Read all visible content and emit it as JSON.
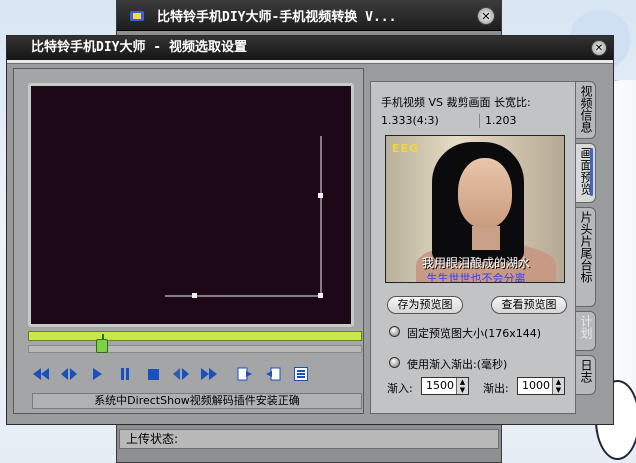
{
  "back_window": {
    "title": "比特铃手机DIY大师-手机视频转换 V...",
    "upload_label": "上传状态:"
  },
  "main_window": {
    "title": "比特铃手机DIY大师 - 视频选取设置"
  },
  "player": {
    "status_text": "系统中DirectShow视频解码插件安装正确",
    "controls": [
      {
        "name": "rewind-icon",
        "glyph": "◀◀"
      },
      {
        "name": "step-back-icon",
        "glyph": "◀▶"
      },
      {
        "name": "play-icon",
        "glyph": "▶"
      },
      {
        "name": "pause-icon",
        "glyph": "❚❚"
      },
      {
        "name": "stop-icon",
        "glyph": "■"
      },
      {
        "name": "step-forward-icon",
        "glyph": "▶▶"
      },
      {
        "name": "fast-forward-icon",
        "glyph": "▶▶"
      },
      {
        "name": "mark-in-icon",
        "glyph": "⎘"
      },
      {
        "name": "mark-out-icon",
        "glyph": "⎗"
      },
      {
        "name": "list-icon",
        "glyph": "☰"
      }
    ]
  },
  "info": {
    "heading": "手机视频 VS 裁剪画面 长宽比:",
    "phone_ratio": "1.333(4:3)",
    "crop_ratio": "1.203"
  },
  "preview": {
    "logo": "EEG",
    "subtitle1": "我用眼泪酿成的湖水",
    "subtitle2": "生生世世也不会分离"
  },
  "buttons": {
    "save_preview": "存为预览图",
    "view_preview": "查看预览图"
  },
  "options": {
    "fixed_size": "固定预览图大小(176x144)",
    "fade": "使用渐入渐出:(毫秒)",
    "fade_in_label": "渐入:",
    "fade_in_value": "1500",
    "fade_out_label": "渐出:",
    "fade_out_value": "1000"
  },
  "tabs": [
    {
      "label": "视频信息",
      "state": "normal"
    },
    {
      "label": "画面预览",
      "state": "active"
    },
    {
      "label": "片头片尾台标",
      "state": "normal"
    },
    {
      "label": "计划",
      "state": "disabled"
    },
    {
      "label": "日志",
      "state": "normal"
    }
  ]
}
